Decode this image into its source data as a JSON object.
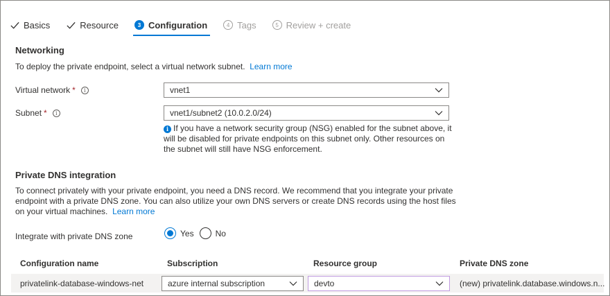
{
  "tabs": [
    {
      "label": "Basics",
      "state": "done"
    },
    {
      "label": "Resource",
      "state": "done"
    },
    {
      "label": "Configuration",
      "state": "active",
      "step": "3"
    },
    {
      "label": "Tags",
      "state": "disabled",
      "step": "4"
    },
    {
      "label": "Review + create",
      "state": "disabled",
      "step": "5"
    }
  ],
  "networking": {
    "title": "Networking",
    "description": "To deploy the private endpoint, select a virtual network subnet.",
    "learn_more": "Learn more",
    "virtual_network": {
      "label": "Virtual network",
      "required": "*",
      "value": "vnet1"
    },
    "subnet": {
      "label": "Subnet",
      "required": "*",
      "value": "vnet1/subnet2 (10.0.2.0/24)"
    },
    "nsg_note": "If you have a network security group (NSG) enabled for the subnet above, it will be disabled for private endpoints on this subnet only. Other resources on the subnet will still have NSG enforcement."
  },
  "dns": {
    "title": "Private DNS integration",
    "description": "To connect privately with your private endpoint, you need a DNS record. We recommend that you integrate your private endpoint with a private DNS zone. You can also utilize your own DNS servers or create DNS records using the host files on your virtual machines.",
    "learn_more": "Learn more",
    "integrate_label": "Integrate with private DNS zone",
    "options": {
      "yes": "Yes",
      "no": "No"
    },
    "selected": "Yes"
  },
  "table": {
    "headers": {
      "config_name": "Configuration name",
      "subscription": "Subscription",
      "resource_group": "Resource group",
      "private_dns_zone": "Private DNS zone"
    },
    "rows": [
      {
        "config_name": "privatelink-database-windows-net",
        "subscription": "azure internal subscription",
        "resource_group": "devto",
        "private_dns_zone": "(new) privatelink.database.windows.n..."
      }
    ]
  },
  "colors": {
    "accent": "#0078d4",
    "required": "#a4262c",
    "text": "#323130"
  }
}
